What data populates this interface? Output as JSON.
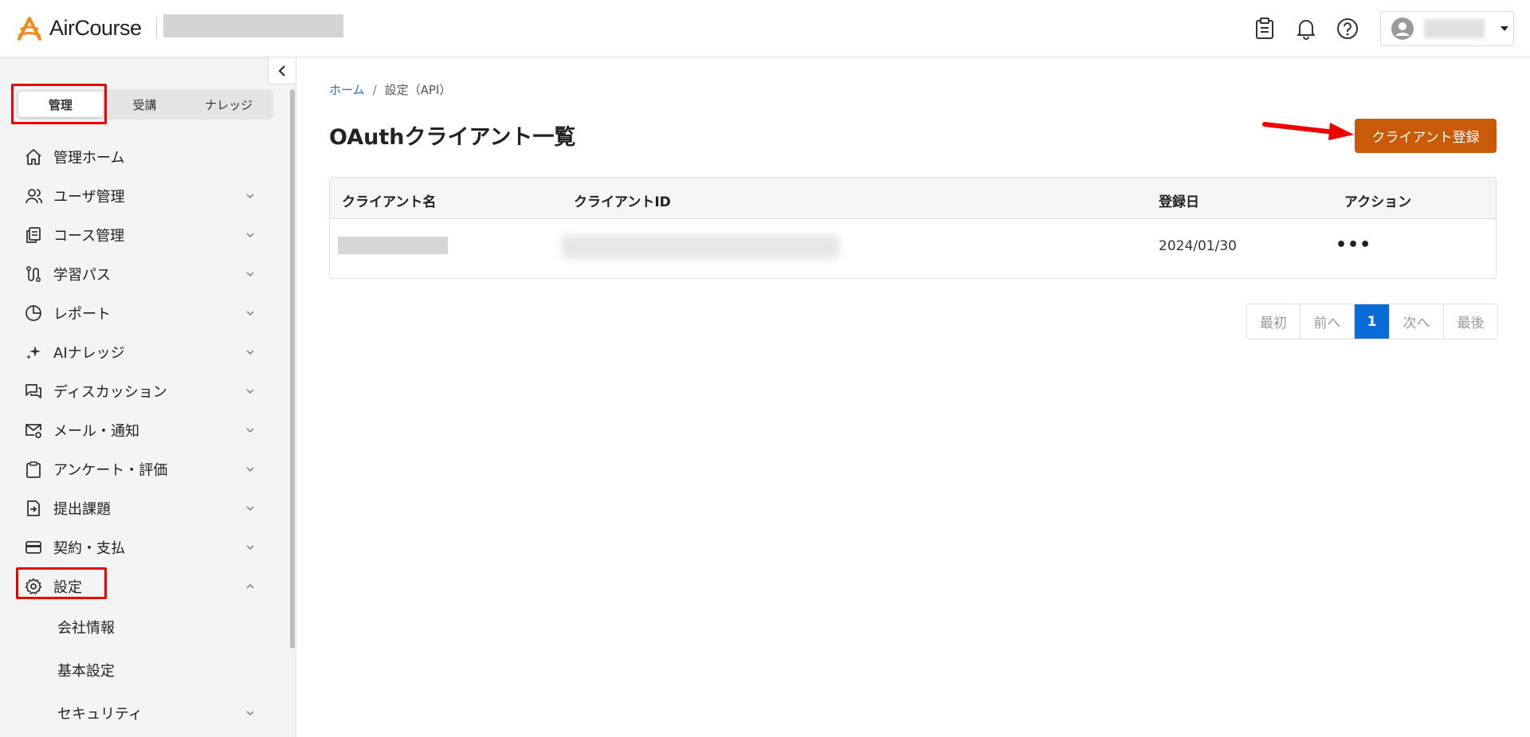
{
  "brand": {
    "name": "AirCourse",
    "accent": "#c85a08",
    "logo_orange": "#f08a1c"
  },
  "header": {
    "icons": [
      "clipboard-icon",
      "bell-icon",
      "help-icon"
    ]
  },
  "sidebar": {
    "tabs": [
      {
        "label": "管理",
        "active": true
      },
      {
        "label": "受講",
        "active": false
      },
      {
        "label": "ナレッジ",
        "active": false
      }
    ],
    "items": [
      {
        "label": "管理ホーム",
        "icon": "home-icon",
        "chevron": "none"
      },
      {
        "label": "ユーザ管理",
        "icon": "users-icon",
        "chevron": "down"
      },
      {
        "label": "コース管理",
        "icon": "copy-icon",
        "chevron": "down"
      },
      {
        "label": "学習パス",
        "icon": "route-icon",
        "chevron": "down"
      },
      {
        "label": "レポート",
        "icon": "pie-chart-icon",
        "chevron": "down"
      },
      {
        "label": "AIナレッジ",
        "icon": "sparkle-icon",
        "chevron": "down"
      },
      {
        "label": "ディスカッション",
        "icon": "chat-icon",
        "chevron": "down"
      },
      {
        "label": "メール・通知",
        "icon": "mail-gear-icon",
        "chevron": "down"
      },
      {
        "label": "アンケート・評価",
        "icon": "clipboard-icon",
        "chevron": "down"
      },
      {
        "label": "提出課題",
        "icon": "submit-icon",
        "chevron": "down"
      },
      {
        "label": "契約・支払",
        "icon": "credit-card-icon",
        "chevron": "down"
      },
      {
        "label": "設定",
        "icon": "gear-icon",
        "chevron": "up"
      }
    ],
    "sub_items": [
      {
        "label": "会社情報",
        "chevron": "none"
      },
      {
        "label": "基本設定",
        "chevron": "none"
      },
      {
        "label": "セキュリティ",
        "chevron": "down"
      }
    ]
  },
  "breadcrumb": {
    "home": "ホーム",
    "separator": "/",
    "current": "設定（API）"
  },
  "page": {
    "title": "OAuthクライアント一覧",
    "register_button": "クライアント登録"
  },
  "table": {
    "headers": [
      "クライアント名",
      "クライアントID",
      "登録日",
      "アクション"
    ],
    "rows": [
      {
        "date": "2024/01/30",
        "action": "•••"
      }
    ]
  },
  "pagination": {
    "first": "最初",
    "prev": "前へ",
    "current": "1",
    "next": "次へ",
    "last": "最後"
  }
}
